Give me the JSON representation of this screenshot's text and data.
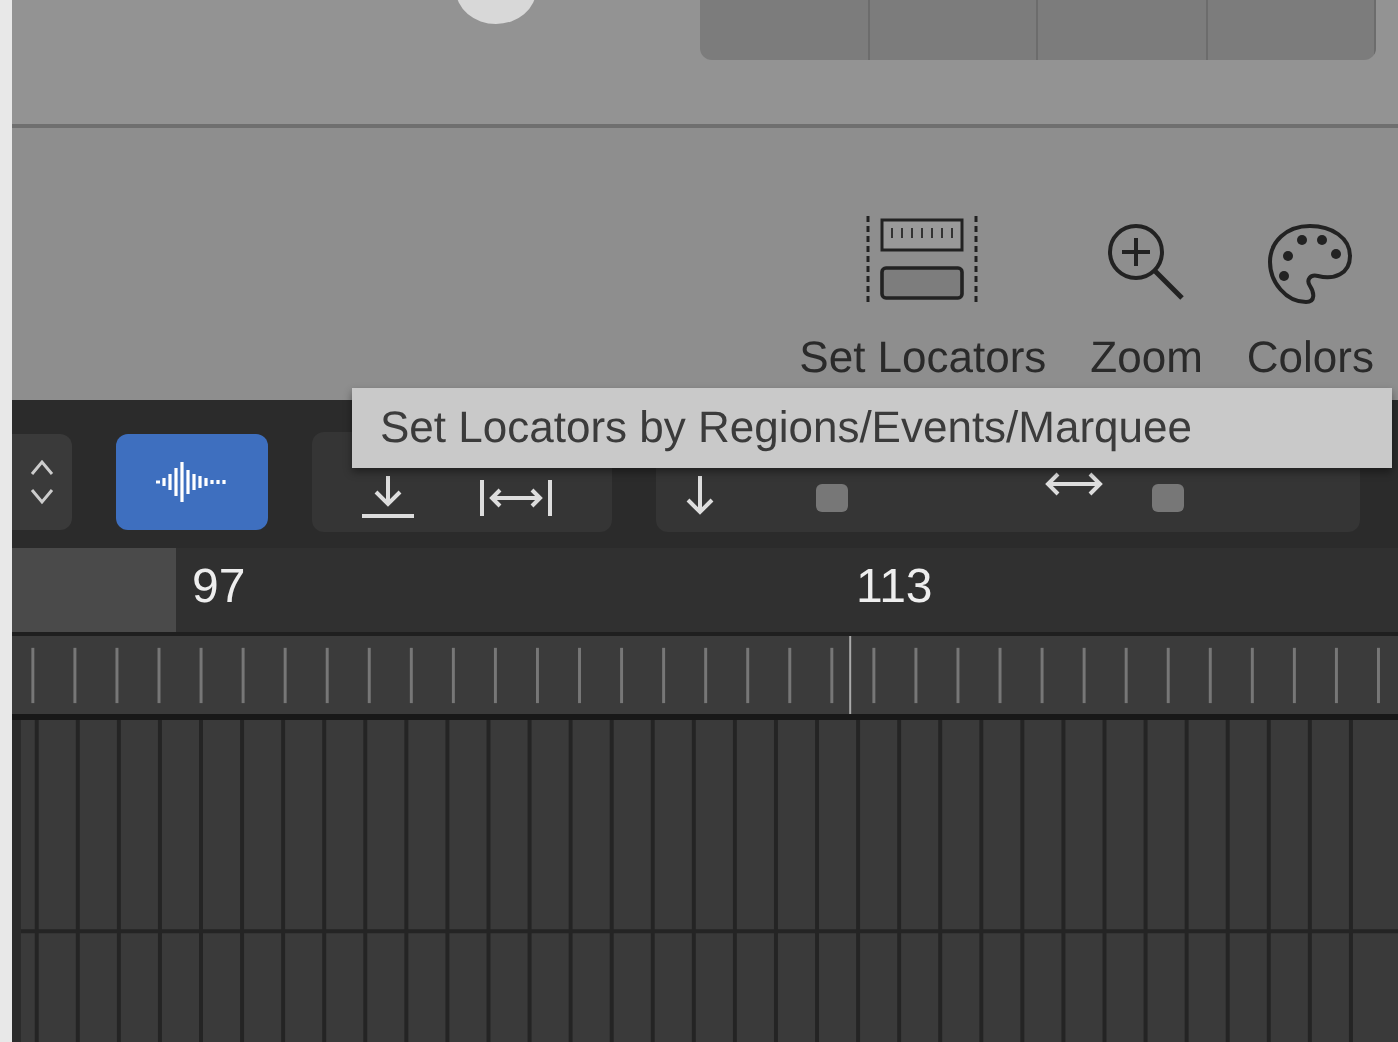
{
  "toolbar": {
    "items": [
      {
        "kind": "locators",
        "label": "Set Locators"
      },
      {
        "kind": "zoom",
        "label": "Zoom"
      },
      {
        "kind": "colors",
        "label": "Colors"
      }
    ]
  },
  "tooltip": {
    "text": "Set Locators by Regions/Events/Marquee"
  },
  "control_bar": {
    "waveform_button": {
      "selected": true
    }
  },
  "ruler": {
    "markers": [
      "97",
      "113"
    ]
  }
}
